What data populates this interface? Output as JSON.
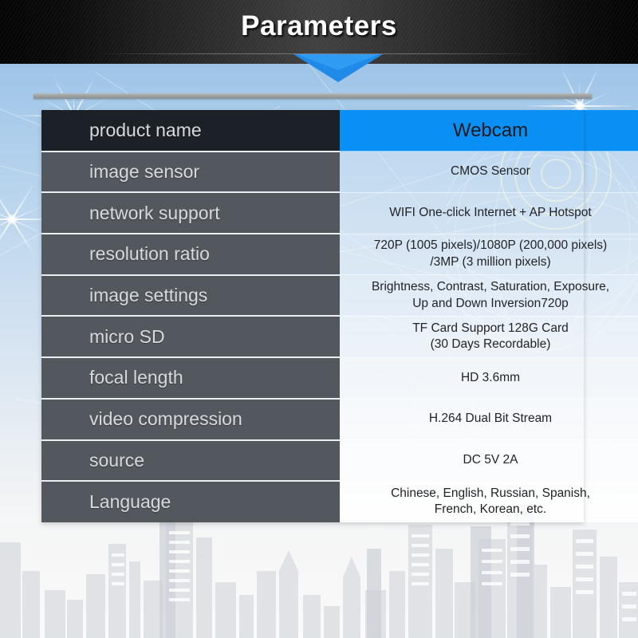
{
  "banner": {
    "title": "Parameters",
    "arrow_icon": "triangle-down-icon",
    "arrow_color": "#1f8ae8",
    "background_color": "#0b0b0b"
  },
  "theme": {
    "accent_blue": "#0a90f5",
    "key_cell_bg": "#53585e",
    "key_cell_first_bg": "#1c2128",
    "key_text_color": "#d8dbde",
    "value_text_color": "#222326",
    "divider_bar_color": "#9da1a3"
  },
  "spec_table": {
    "rows": [
      {
        "key": "product name",
        "value_line1": "Webcam",
        "value_line2": "",
        "highlight": true
      },
      {
        "key": "image sensor",
        "value_line1": "CMOS Sensor",
        "value_line2": "",
        "highlight": false
      },
      {
        "key": "network support",
        "value_line1": "WIFI One-click Internet + AP Hotspot",
        "value_line2": "",
        "highlight": false
      },
      {
        "key": "resolution ratio",
        "value_line1": "720P (1005 pixels)/1080P (200,000 pixels)",
        "value_line2": "/3MP (3 million pixels)",
        "highlight": false
      },
      {
        "key": "image settings",
        "value_line1": "Brightness, Contrast, Saturation, Exposure,",
        "value_line2": "Up and Down Inversion720p",
        "highlight": false
      },
      {
        "key": "micro SD",
        "value_line1": "TF Card Support 128G Card",
        "value_line2": "(30 Days Recordable)",
        "highlight": false
      },
      {
        "key": "focal length",
        "value_line1": "HD 3.6mm",
        "value_line2": "",
        "highlight": false
      },
      {
        "key": "video compression",
        "value_line1": "H.264 Dual Bit Stream",
        "value_line2": "",
        "highlight": false
      },
      {
        "key": "source",
        "value_line1": "DC 5V 2A",
        "value_line2": "",
        "highlight": false
      },
      {
        "key": "Language",
        "value_line1": "Chinese, English, Russian, Spanish,",
        "value_line2": "French, Korean, etc.",
        "highlight": false
      }
    ]
  },
  "decorations": {
    "star_flare_icon": "star-flare-icon",
    "radar_rings_icon": "concentric-rings-icon",
    "globe_icon": "globe-wireframe-icon",
    "cityscape_icon": "cityscape-silhouette-icon",
    "divider_bar_icon": "horizontal-divider-icon"
  }
}
